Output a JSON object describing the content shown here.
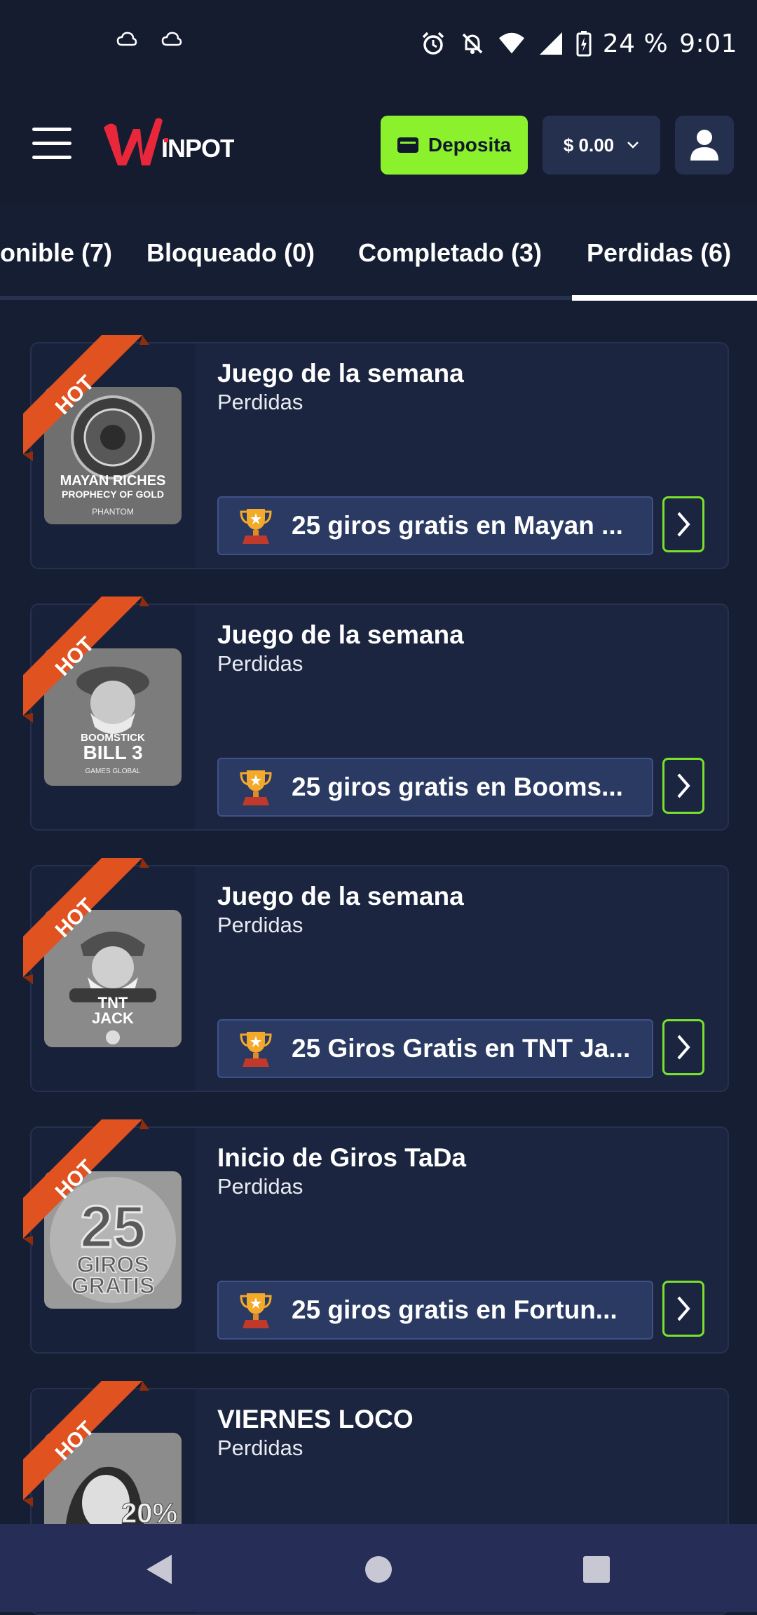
{
  "status_bar": {
    "battery": "24 %",
    "time": "9:01",
    "icons": [
      "cloud-icon",
      "cloud-icon",
      "alarm-icon",
      "notifications-off-icon",
      "wifi-icon",
      "signal-icon",
      "battery-charging-icon"
    ]
  },
  "header": {
    "logo_text": "WINPOT",
    "deposit_label": "Deposita",
    "balance": "$ 0.00",
    "colors": {
      "deposit": "#8bf12c",
      "logo_red": "#e8283a"
    }
  },
  "tabs": [
    {
      "label": "onible (7)"
    },
    {
      "label": "Bloqueado (0)"
    },
    {
      "label": "Completado (3)"
    },
    {
      "label": "Perdidas (6)",
      "active": true
    }
  ],
  "cards": [
    {
      "badge": "HOT",
      "title": "Juego de la semana",
      "status": "Perdidas",
      "promo": "25 giros gratis en Mayan ...",
      "thumb_text": [
        "MAYAN RICHES",
        "PROPHECY OF GOLD",
        "PHANTOM"
      ]
    },
    {
      "badge": "HOT",
      "title": "Juego de la semana",
      "status": "Perdidas",
      "promo": "25 giros gratis en Booms...",
      "thumb_text": [
        "BOOMSTICK",
        "BILL 3",
        "GAMES GLOBAL"
      ]
    },
    {
      "badge": "HOT",
      "title": "Juego de la semana",
      "status": "Perdidas",
      "promo": "25 Giros Gratis en TNT Ja...",
      "thumb_text": [
        "TNT",
        "JACK"
      ]
    },
    {
      "badge": "HOT",
      "title": "Inicio de Giros TaDa",
      "status": "Perdidas",
      "promo": "25 giros gratis en Fortun...",
      "thumb_text": [
        "25",
        "GIROS",
        "GRATIS"
      ]
    },
    {
      "badge": "HOT",
      "title": "VIERNES LOCO",
      "status": "Perdidas",
      "thumb_text": [
        "20%"
      ]
    }
  ]
}
